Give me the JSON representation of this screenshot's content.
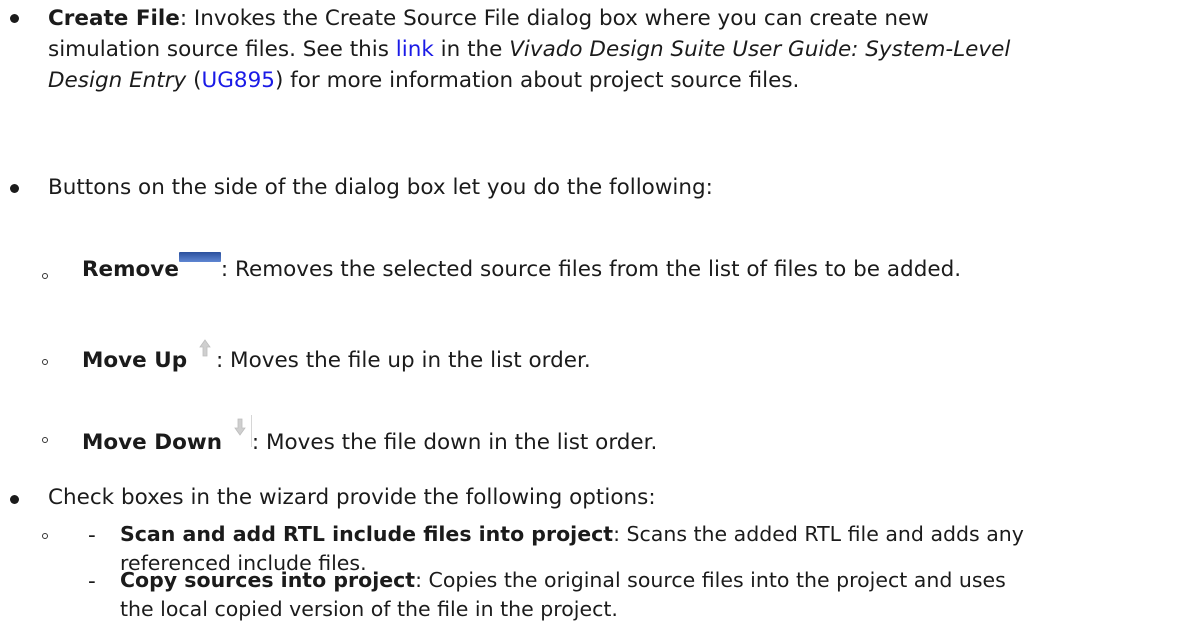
{
  "items": {
    "create_file": {
      "term": "Create File",
      "desc_1": ": Invokes the Create Source File dialog box where you can create new",
      "desc_2a": "simulation source files. See this ",
      "link": "link",
      "desc_2b": " in the ",
      "book": "Vivado Design Suite User Guide: System-Level",
      "book_2": "Design Entry",
      "desc_3a": " (",
      "doc_id": "UG895",
      "desc_3b": ") for more information about project source files."
    },
    "buttons_intro": "Buttons on the side of the dialog box let you do the following:",
    "remove": {
      "term": "Remove",
      "desc": ": Removes the selected source files from the list of files to be added."
    },
    "move_up": {
      "term": "Move Up",
      "desc": ": Moves the file up in the list order."
    },
    "move_down": {
      "term": "Move Down",
      "desc": ": Moves the file down in the list order."
    },
    "checkbox_intro": "Check boxes in the wizard provide the following options:",
    "scan": {
      "dash": "-",
      "term": "Scan and add RTL include files into project",
      "desc_1": ": Scans the added RTL file and adds any",
      "desc_2": "referenced include files."
    },
    "copy": {
      "dash": "-",
      "term": "Copy sources into project",
      "desc_1": ": Copies the original source files into the project and uses",
      "desc_2": "the local copied version of the file in the project."
    }
  },
  "colors": {
    "link": "#1a1ae6",
    "text": "#1b1b1b",
    "remove_icon": "#3a62b8"
  },
  "icons": {
    "remove": "remove-icon",
    "move_up": "up-arrow-icon",
    "move_down": "down-arrow-icon"
  }
}
